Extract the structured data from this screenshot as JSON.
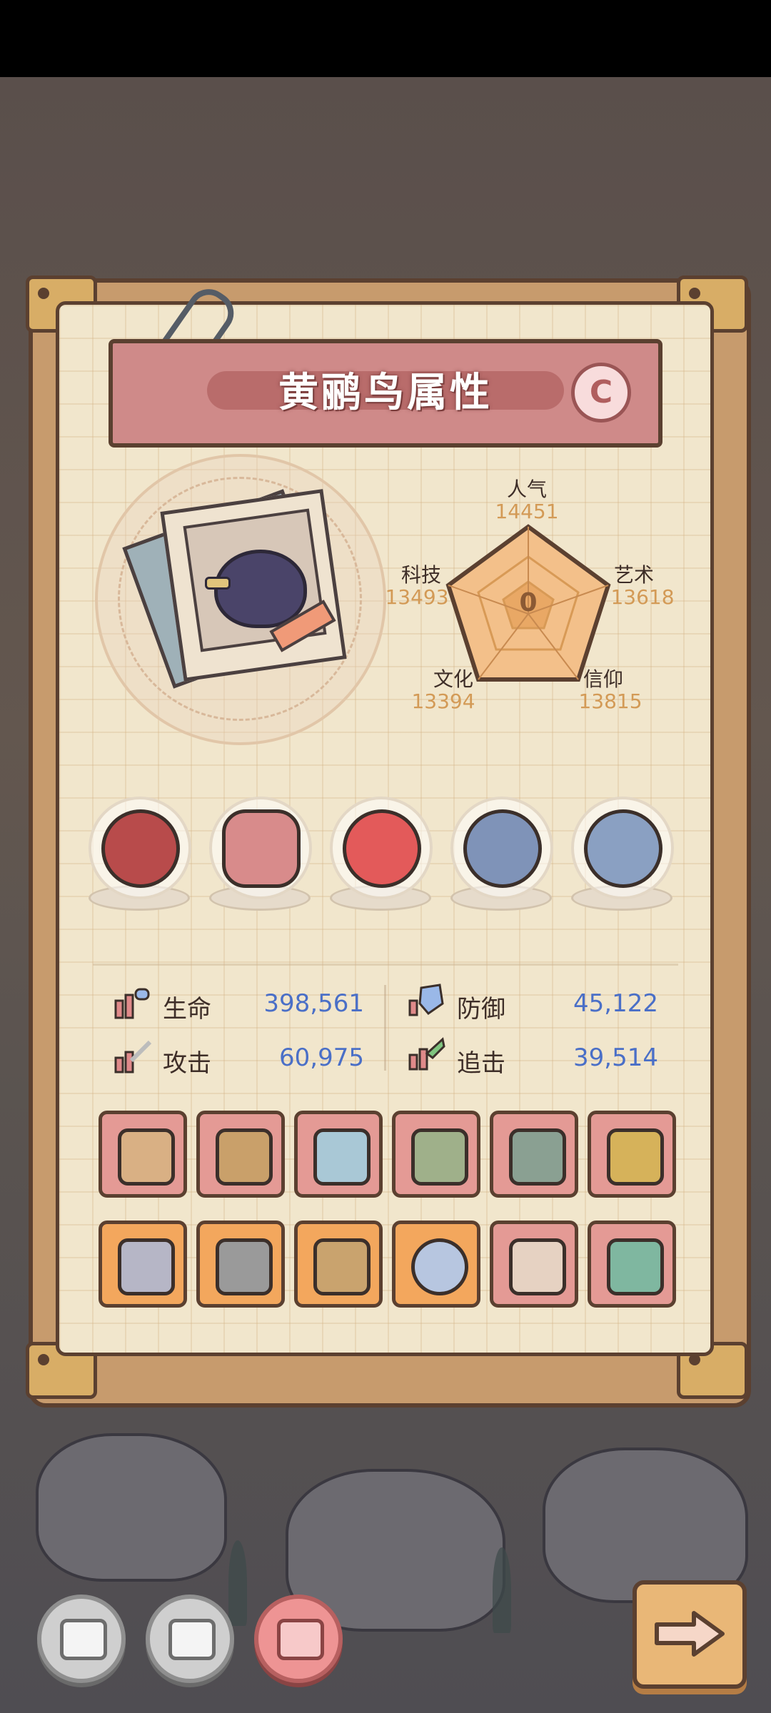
{
  "title": "黄鹂鸟属性",
  "grade": "C",
  "radar": {
    "center_value": "0",
    "stats": [
      {
        "label": "人气",
        "value": "14451"
      },
      {
        "label": "艺术",
        "value": "13618"
      },
      {
        "label": "信仰",
        "value": "13815"
      },
      {
        "label": "文化",
        "value": "13394"
      },
      {
        "label": "科技",
        "value": "13493"
      }
    ]
  },
  "relics": [
    "thorn-wreath-icon",
    "monster-mask-icon",
    "spiral-shell-icon",
    "compass-icon",
    "gem-cluster-icon"
  ],
  "stats": {
    "hp_label": "生命",
    "hp_value": "398,561",
    "def_label": "防御",
    "def_value": "45,122",
    "atk_label": "攻击",
    "atk_value": "60,975",
    "chase_label": "追击",
    "chase_value": "39,514"
  },
  "equipment_row1": [
    "crossbow-icon",
    "skull-mace-icon",
    "sword-icon",
    "axe-icon",
    "hammer-icon",
    "crown-shield-icon"
  ],
  "equipment_row2": [
    "winged-emblem-icon",
    "pickaxe-icon",
    "bracer-icon",
    "ring-icon",
    "robe-icon",
    "serpent-staff-icon"
  ],
  "bottom_tabs": [
    "tab-1",
    "tab-2",
    "tab-3"
  ]
}
